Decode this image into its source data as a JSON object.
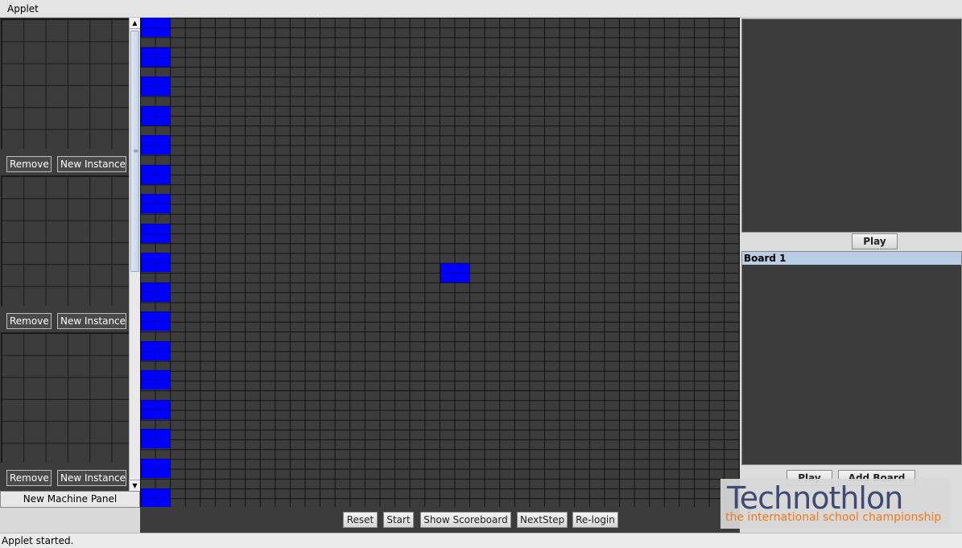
{
  "menubar": {
    "title": "Applet"
  },
  "machines": [
    {
      "remove_label": "Remove",
      "new_instance_label": "New Instance"
    },
    {
      "remove_label": "Remove",
      "new_instance_label": "New Instance"
    },
    {
      "remove_label": "Remove",
      "new_instance_label": "New Instance"
    }
  ],
  "left": {
    "new_machine_label": "New Machine Panel"
  },
  "controls": {
    "reset": "Reset",
    "start": "Start",
    "show_scoreboard": "Show Scoreboard",
    "next_step": "NextStep",
    "relogin": "Re-login"
  },
  "right": {
    "play_label": "Play",
    "board_item": "Board 1",
    "play_label_2": "Play",
    "add_board_label": "Add Board"
  },
  "logo": {
    "name": "Technothlon",
    "tagline": "the international school championship"
  },
  "status": {
    "text": "Applet started."
  },
  "colors": {
    "cell_active": "#0000ff",
    "board_bg": "#3c3c3c",
    "selection": "#b9cde4",
    "logo_tagline": "#f07a1a"
  }
}
